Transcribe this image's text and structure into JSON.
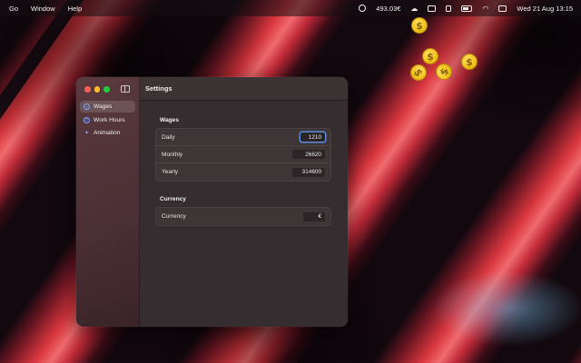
{
  "menubar": {
    "items": [
      "Go",
      "Window",
      "Help"
    ],
    "earnings": "493.03€",
    "datetime": "Wed 21 Aug  13:15"
  },
  "coins": {
    "symbol": "$",
    "count": 6
  },
  "window": {
    "title": "Settings",
    "sidebar": {
      "items": [
        {
          "label": "Wages",
          "icon": "info-icon",
          "active": true
        },
        {
          "label": "Work Hours",
          "icon": "clock-icon",
          "active": false
        },
        {
          "label": "Animation",
          "icon": "sparkles-icon",
          "active": false
        }
      ]
    },
    "wages": {
      "title": "Wages",
      "daily_label": "Daily",
      "daily_value": "1210",
      "monthly_label": "Monthly",
      "monthly_value": "26620",
      "yearly_label": "Yearly",
      "yearly_value": "314600"
    },
    "currency": {
      "title": "Currency",
      "label": "Currency",
      "value": "€"
    }
  },
  "colors": {
    "accent": "#5b8dd9",
    "close": "#fe5f57",
    "minimize": "#febc2e",
    "zoom": "#28c840",
    "coin": "#f2c21a"
  }
}
